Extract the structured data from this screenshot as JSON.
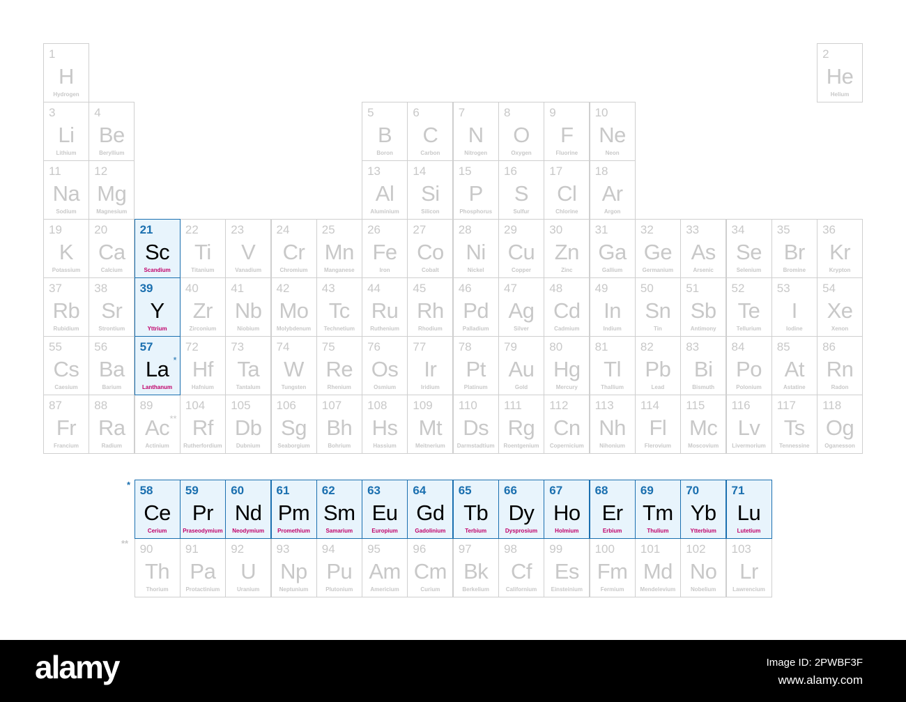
{
  "colors": {
    "highlight_bg": "#e8f4fc",
    "highlight_border": "#1a6faf",
    "name_highlight": "#c0006a",
    "muted": "#c8c8c8"
  },
  "highlighted": [
    21,
    39,
    57,
    58,
    59,
    60,
    61,
    62,
    63,
    64,
    65,
    66,
    67,
    68,
    69,
    70,
    71
  ],
  "markers": {
    "lanthanide": "*",
    "actinide": "**"
  },
  "elements": [
    "H|Hydrogen",
    "He|Helium",
    "Li|Lithium",
    "Be|Beryllium",
    "B|Boron",
    "C|Carbon",
    "N|Nitrogen",
    "O|Oxygen",
    "F|Fluorine",
    "Ne|Neon",
    "Na|Sodium",
    "Mg|Magnesium",
    "Al|Aluminium",
    "Si|Silicon",
    "P|Phosphorus",
    "S|Sulfur",
    "Cl|Chlorine",
    "Ar|Argon",
    "K|Potassium",
    "Ca|Calcium",
    "Sc|Scandium",
    "Ti|Titanium",
    "V|Vanadium",
    "Cr|Chromium",
    "Mn|Manganese",
    "Fe|Iron",
    "Co|Cobalt",
    "Ni|Nickel",
    "Cu|Copper",
    "Zn|Zinc",
    "Ga|Gallium",
    "Ge|Germanium",
    "As|Arsenic",
    "Se|Selenium",
    "Br|Bromine",
    "Kr|Krypton",
    "Rb|Rubidium",
    "Sr|Strontium",
    "Y|Yttrium",
    "Zr|Zirconium",
    "Nb|Niobium",
    "Mo|Molybdenum",
    "Tc|Technetium",
    "Ru|Ruthenium",
    "Rh|Rhodium",
    "Pd|Palladium",
    "Ag|Silver",
    "Cd|Cadmium",
    "In|Indium",
    "Sn|Tin",
    "Sb|Antimony",
    "Te|Tellurium",
    "I|Iodine",
    "Xe|Xenon",
    "Cs|Caesium",
    "Ba|Barium",
    "La|Lanthanum",
    "Ce|Cerium",
    "Pr|Praseodymium",
    "Nd|Neodymium",
    "Pm|Promethium",
    "Sm|Samarium",
    "Eu|Europium",
    "Gd|Gadolinium",
    "Tb|Terbium",
    "Dy|Dysprosium",
    "Ho|Holmium",
    "Er|Erbium",
    "Tm|Thulium",
    "Yb|Ytterbium",
    "Lu|Lutetium",
    "Hf|Hafnium",
    "Ta|Tantalum",
    "W|Tungsten",
    "Re|Rhenium",
    "Os|Osmium",
    "Ir|Iridium",
    "Pt|Platinum",
    "Au|Gold",
    "Hg|Mercury",
    "Tl|Thallium",
    "Pb|Lead",
    "Bi|Bismuth",
    "Po|Polonium",
    "At|Astatine",
    "Rn|Radon",
    "Fr|Francium",
    "Ra|Radium",
    "Ac|Actinium",
    "Th|Thorium",
    "Pa|Protactinium",
    "U|Uranium",
    "Np|Neptunium",
    "Pu|Plutonium",
    "Am|Americium",
    "Cm|Curium",
    "Bk|Berkelium",
    "Cf|Californium",
    "Es|Einsteinium",
    "Fm|Fermium",
    "Md|Mendelevium",
    "No|Nobelium",
    "Lr|Lawrencium",
    "Rf|Rutherfordium",
    "Db|Dubnium",
    "Sg|Seaborgium",
    "Bh|Bohrium",
    "Hs|Hassium",
    "Mt|Meitnerium",
    "Ds|Darmstadtium",
    "Rg|Roentgenium",
    "Cn|Copernicium",
    "Nh|Nihonium",
    "Fl|Flerovium",
    "Mc|Moscovium",
    "Lv|Livermorium",
    "Ts|Tennessine",
    "Og|Oganesson"
  ],
  "footer": {
    "logo": "alamy",
    "image_id": "Image ID: 2PWBF3F",
    "site": "www.alamy.com"
  }
}
